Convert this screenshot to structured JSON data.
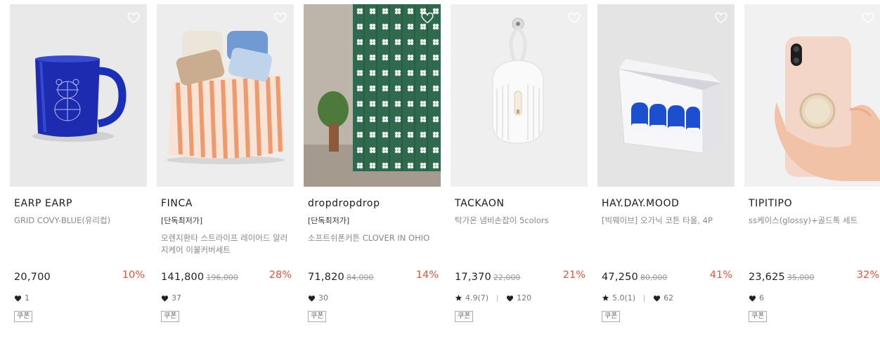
{
  "products": [
    {
      "brand": "EARP EARP",
      "badge": "",
      "name": "GRID COVY-BLUE(유리컵)",
      "price": "20,700",
      "original_price": "",
      "discount": "10%",
      "rating": "",
      "likes": "1",
      "coupon": "쿠폰"
    },
    {
      "brand": "FINCA",
      "badge": "[단독최저가]",
      "name": "오렌지환타 스트라이프 레이어드 알러지케어 이불커버세트",
      "price": "141,800",
      "original_price": "196,000",
      "discount": "28%",
      "rating": "",
      "likes": "37",
      "coupon": "쿠폰"
    },
    {
      "brand": "dropdropdrop",
      "badge": "[단독최저가]",
      "name": "소프트쉬폰커튼 CLOVER IN OHIO",
      "price": "71,820",
      "original_price": "84,000",
      "discount": "14%",
      "rating": "",
      "likes": "30",
      "coupon": "쿠폰"
    },
    {
      "brand": "TACKAON",
      "badge": "",
      "name": "탁가온 냄비손잡이 5colors",
      "price": "17,370",
      "original_price": "22,000",
      "discount": "21%",
      "rating": "4.9(7)",
      "likes": "120",
      "coupon": "쿠폰"
    },
    {
      "brand": "HAY.DAY.MOOD",
      "badge": "",
      "name": "[빅웨이브] 오가닉 코튼 타올, 4P",
      "price": "47,250",
      "original_price": "80,000",
      "discount": "41%",
      "rating": "5.0(1)",
      "likes": "62",
      "coupon": "쿠폰"
    },
    {
      "brand": "TIPITIPO",
      "badge": "",
      "name": "ss케이스(glossy)+골드톡 세트",
      "price": "23,625",
      "original_price": "35,000",
      "discount": "32%",
      "rating": "",
      "likes": "6",
      "coupon": "쿠폰"
    }
  ],
  "colors": {
    "discount": "#e8533a",
    "text": "#222222",
    "muted": "#888888"
  },
  "icons": {
    "wishlist": "heart-outline-icon",
    "likes": "heart-icon",
    "rating": "star-icon"
  }
}
